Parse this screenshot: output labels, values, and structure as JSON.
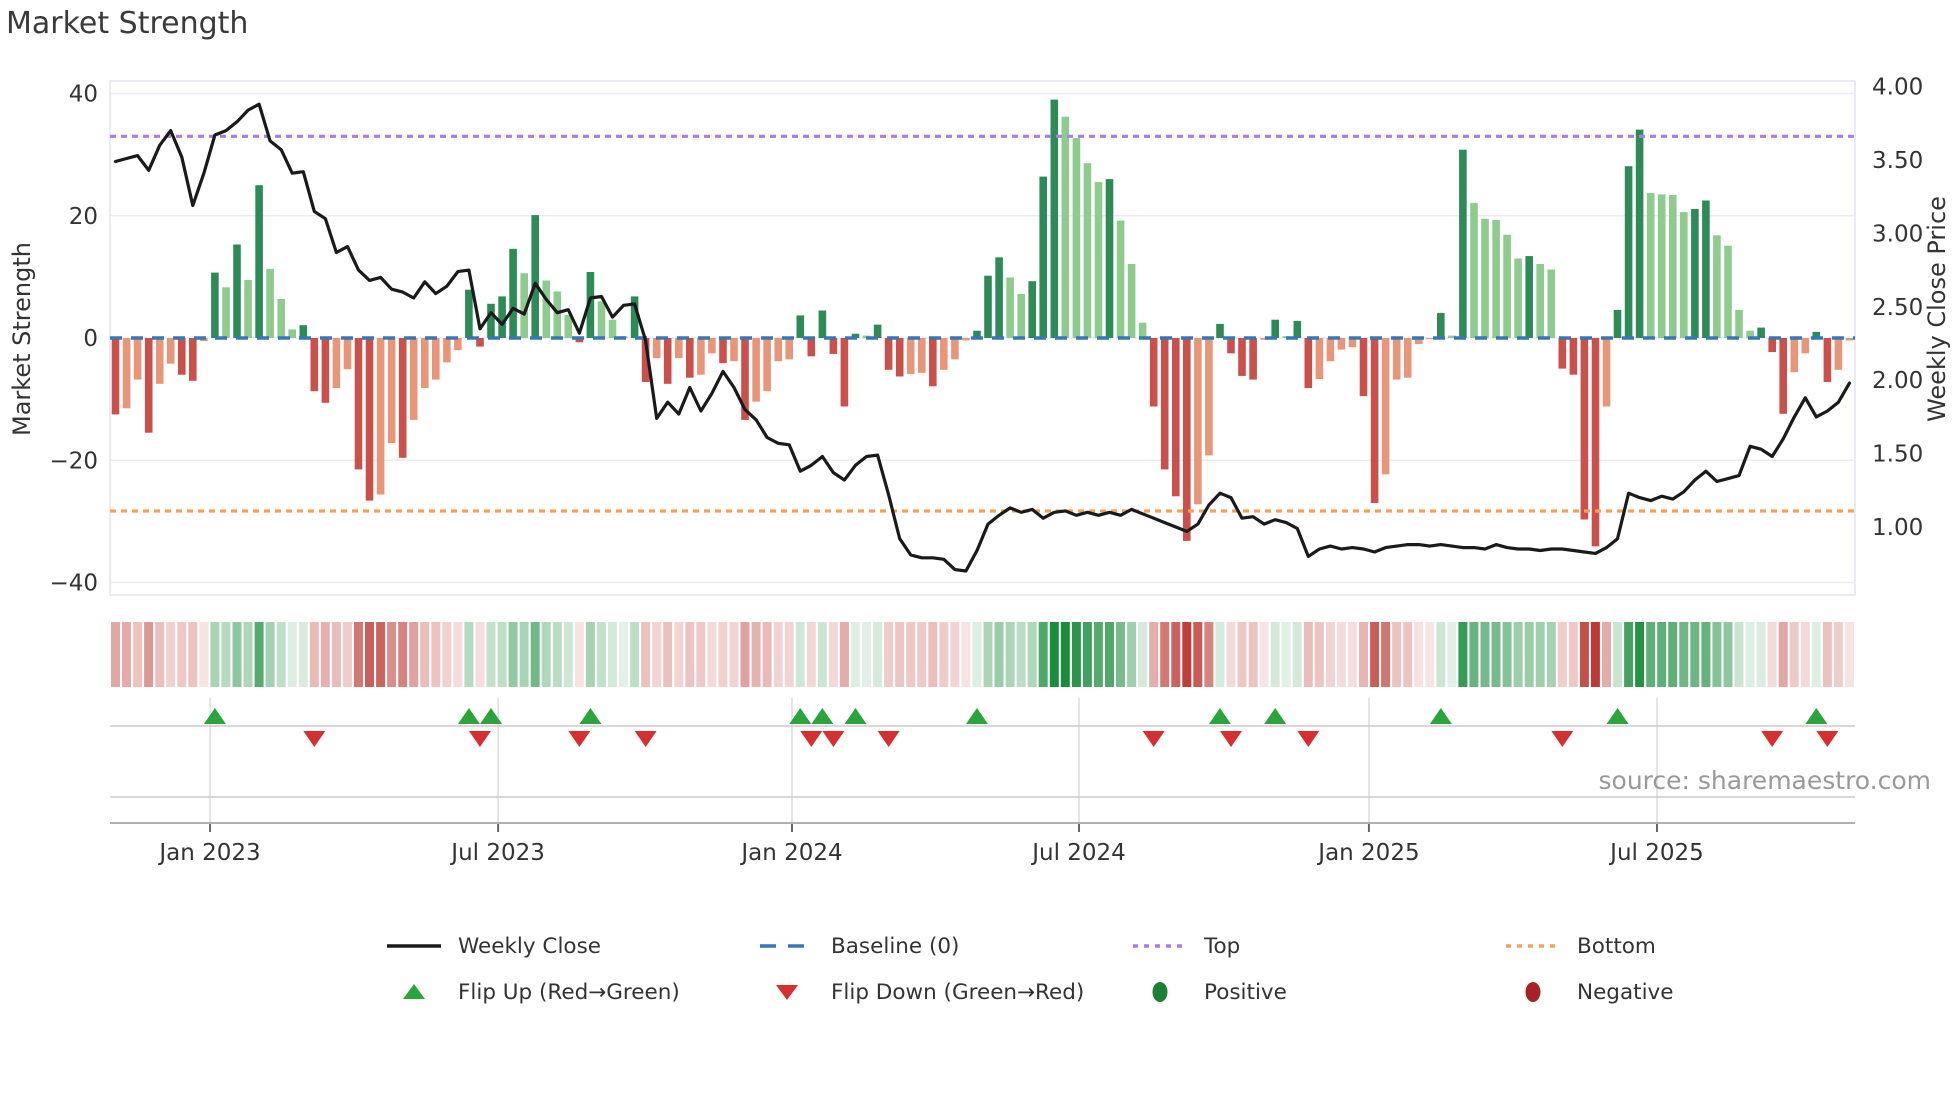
{
  "title": "Market Strength",
  "source": "source: sharemaestro.com",
  "axes": {
    "left": {
      "title": "Market Strength",
      "ticks": [
        {
          "label": "40",
          "value": 40
        },
        {
          "label": "20",
          "value": 20
        },
        {
          "label": "0",
          "value": 0
        },
        {
          "label": "−20",
          "value": -20
        },
        {
          "label": "−40",
          "value": -40
        }
      ]
    },
    "right": {
      "title": "Weekly Close Price",
      "ticks": [
        {
          "label": "4.00",
          "value": 4.0
        },
        {
          "label": "3.50",
          "value": 3.5
        },
        {
          "label": "3.00",
          "value": 3.0
        },
        {
          "label": "2.50",
          "value": 2.5
        },
        {
          "label": "2.00",
          "value": 2.0
        },
        {
          "label": "1.50",
          "value": 1.5
        },
        {
          "label": "1.00",
          "value": 1.0
        }
      ]
    },
    "x": {
      "ticks": [
        {
          "label": "Jan 2023",
          "week": 8.56
        },
        {
          "label": "Jul 2023",
          "week": 34.64
        },
        {
          "label": "Jan 2024",
          "week": 61.25
        },
        {
          "label": "Jul 2024",
          "week": 87.24
        },
        {
          "label": "Jan 2025",
          "week": 113.49
        },
        {
          "label": "Jul 2025",
          "week": 139.57
        }
      ]
    }
  },
  "legend": {
    "items": [
      {
        "label": "Weekly Close",
        "swatch": "line-black"
      },
      {
        "label": "Baseline (0)",
        "swatch": "line-dashed-blue"
      },
      {
        "label": "Top",
        "swatch": "line-dotted-purple"
      },
      {
        "label": "Bottom",
        "swatch": "line-dotted-orange"
      },
      {
        "label": "Flip Up (Red→Green)",
        "swatch": "triangle-up-green"
      },
      {
        "label": "Flip Down (Green→Red)",
        "swatch": "triangle-down-red"
      },
      {
        "label": "Positive",
        "swatch": "circle-green"
      },
      {
        "label": "Negative",
        "swatch": "circle-red"
      }
    ]
  },
  "chart_data": {
    "type": "bar",
    "title": "Market Strength",
    "xlabel": "",
    "ylabel_left": "Market Strength",
    "ylabel_right": "Weekly Close Price",
    "ylim_left": [
      -42,
      42
    ],
    "ylim_right": [
      0.62,
      4.05
    ],
    "top_line": 33,
    "bottom_line": -28.3,
    "baseline": 0,
    "grid": "horizontal",
    "legend_position": "bottom",
    "series": [
      {
        "name": "Market Strength (weekly bars)",
        "values": [
          -12.5,
          -11.5,
          -6.8,
          -15.5,
          -7.5,
          -4.2,
          -6,
          -7,
          -0.5,
          10.7,
          8.3,
          15.3,
          9.5,
          25,
          11.3,
          6.4,
          1.4,
          2.1,
          -8.7,
          -10.6,
          -8.2,
          -5.1,
          -21.5,
          -26.6,
          -25.6,
          -17.2,
          -19.6,
          -13.4,
          -8.2,
          -6.8,
          -4,
          -2,
          7.9,
          -1.4,
          5.6,
          6.8,
          14.6,
          10.6,
          20.1,
          9.4,
          7.6,
          3.8,
          -0.7,
          10.8,
          6,
          3,
          0.3,
          6.8,
          -7.2,
          -3.3,
          -7.5,
          -3.3,
          -6.5,
          -6,
          -2.5,
          -4.1,
          -3.8,
          -13.4,
          -10.4,
          -8.7,
          -3.8,
          -3.5,
          3.7,
          -3,
          4.5,
          -2.6,
          -11.2,
          0.7,
          0.4,
          2.2,
          -5.2,
          -6.3,
          -5.9,
          -5.7,
          -7.9,
          -5.2,
          -3.5,
          -0.4,
          1.2,
          10.2,
          13.2,
          9.9,
          7.2,
          9.3,
          26.4,
          39,
          36.2,
          32.7,
          28.6,
          25.5,
          26,
          19.2,
          12.1,
          2.5,
          -11.2,
          -21.5,
          -25.9,
          -33.2,
          -27.2,
          -19.2,
          2.3,
          -2.5,
          -6.2,
          -6.8,
          -0.3,
          3,
          0.3,
          2.8,
          -8.2,
          -6.7,
          -3.8,
          -1.9,
          -1.5,
          -9.5,
          -27,
          -22.3,
          -6.8,
          -6.5,
          -1,
          -0.2,
          4.1,
          0.4,
          30.8,
          22.1,
          19.5,
          19.3,
          16.9,
          13,
          13.4,
          12.1,
          11.2,
          -5,
          -6,
          -29.7,
          -34.1,
          -11.2,
          4.6,
          28.1,
          34.1,
          23.7,
          23.5,
          23.4,
          20.6,
          21.1,
          22.5,
          16.8,
          15.1,
          4.6,
          1.2,
          1.7,
          -2.3,
          -12.4,
          -5.6,
          -2.5,
          1,
          -7.2,
          -5.2,
          -0.4
        ]
      },
      {
        "name": "Weekly Close",
        "values": [
          3.49,
          3.51,
          3.53,
          3.43,
          3.6,
          3.7,
          3.52,
          3.19,
          3.41,
          3.67,
          3.7,
          3.76,
          3.84,
          3.88,
          3.63,
          3.57,
          3.41,
          3.42,
          3.15,
          3.1,
          2.87,
          2.91,
          2.75,
          2.68,
          2.7,
          2.62,
          2.6,
          2.56,
          2.67,
          2.59,
          2.64,
          2.74,
          2.75,
          2.35,
          2.46,
          2.38,
          2.49,
          2.45,
          2.66,
          2.55,
          2.46,
          2.48,
          2.32,
          2.56,
          2.57,
          2.43,
          2.51,
          2.52,
          2.27,
          1.74,
          1.85,
          1.77,
          1.95,
          1.79,
          1.91,
          2.06,
          1.95,
          1.8,
          1.73,
          1.61,
          1.57,
          1.56,
          1.38,
          1.42,
          1.48,
          1.37,
          1.32,
          1.42,
          1.48,
          1.49,
          1.22,
          0.92,
          0.81,
          0.79,
          0.79,
          0.78,
          0.71,
          0.7,
          0.84,
          1.02,
          1.08,
          1.13,
          1.1,
          1.12,
          1.06,
          1.1,
          1.11,
          1.08,
          1.1,
          1.08,
          1.1,
          1.08,
          1.12,
          1.09,
          1.06,
          1.03,
          1.0,
          0.97,
          1.02,
          1.15,
          1.23,
          1.2,
          1.06,
          1.07,
          1.02,
          1.05,
          1.03,
          0.99,
          0.8,
          0.85,
          0.87,
          0.85,
          0.86,
          0.85,
          0.83,
          0.86,
          0.87,
          0.88,
          0.88,
          0.87,
          0.88,
          0.87,
          0.86,
          0.86,
          0.85,
          0.88,
          0.86,
          0.85,
          0.85,
          0.84,
          0.85,
          0.85,
          0.84,
          0.83,
          0.82,
          0.86,
          0.92,
          1.23,
          1.2,
          1.18,
          1.21,
          1.19,
          1.24,
          1.32,
          1.38,
          1.31,
          1.33,
          1.35,
          1.55,
          1.53,
          1.48,
          1.6,
          1.75,
          1.88,
          1.75,
          1.79,
          1.85,
          1.98
        ]
      }
    ],
    "heatmap": "mirror of bar values, diverging red-white-green strip",
    "flip_rule": "marker rows derived from bar sign changes: up = red→green, down = green→red",
    "colors": {
      "bar_pos_strong": "#2e8b57",
      "bar_pos_weak": "#8fca8f",
      "bar_neg_strong": "#c9504b",
      "bar_neg_weak": "#e8967a",
      "price_line": "#1a1a1a",
      "baseline": "#3677b5",
      "top": "#a97de2",
      "bottom": "#f4a259",
      "flip_up": "#2ba43b",
      "flip_down": "#d62f2f",
      "positive_dot": "#1e7e34",
      "negative_dot": "#a82124",
      "heat_pos": "#1a8c3c",
      "heat_neg": "#b9302a",
      "grid": "#ebebf4"
    }
  }
}
